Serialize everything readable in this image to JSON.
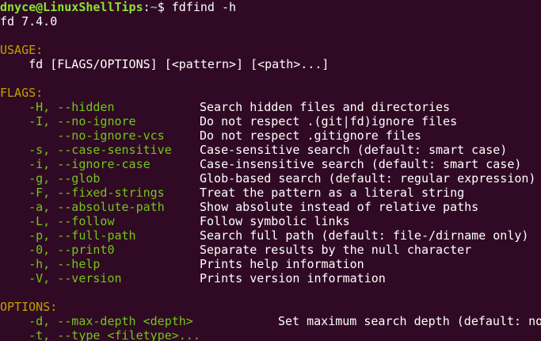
{
  "prompt": {
    "user_host": "dnyce@LinuxShellTips",
    "separator": ":",
    "cwd": "~",
    "symbol": "$",
    "command": "fdfind -h"
  },
  "version_line": "fd 7.4.0",
  "usage": {
    "header": "USAGE:",
    "line": "    fd [FLAGS/OPTIONS] [<pattern>] [<path>...]"
  },
  "flags": {
    "header": "FLAGS:",
    "items": [
      {
        "flag": "    -H, --hidden",
        "desc": "Search hidden files and directories"
      },
      {
        "flag": "    -I, --no-ignore",
        "desc": "Do not respect .(git|fd)ignore files"
      },
      {
        "flag": "        --no-ignore-vcs",
        "desc": "Do not respect .gitignore files"
      },
      {
        "flag": "    -s, --case-sensitive",
        "desc": "Case-sensitive search (default: smart case)"
      },
      {
        "flag": "    -i, --ignore-case",
        "desc": "Case-insensitive search (default: smart case)"
      },
      {
        "flag": "    -g, --glob",
        "desc": "Glob-based search (default: regular expression)"
      },
      {
        "flag": "    -F, --fixed-strings",
        "desc": "Treat the pattern as a literal string"
      },
      {
        "flag": "    -a, --absolute-path",
        "desc": "Show absolute instead of relative paths"
      },
      {
        "flag": "    -L, --follow",
        "desc": "Follow symbolic links"
      },
      {
        "flag": "    -p, --full-path",
        "desc": "Search full path (default: file-/dirname only)"
      },
      {
        "flag": "    -0, --print0",
        "desc": "Separate results by the null character"
      },
      {
        "flag": "    -h, --help",
        "desc": "Prints help information"
      },
      {
        "flag": "    -V, --version",
        "desc": "Prints version information"
      }
    ]
  },
  "options": {
    "header": "OPTIONS:",
    "items": [
      {
        "flag": "    -d, --max-depth <depth>",
        "desc": "Set maximum search depth (default: no"
      },
      {
        "flag": "    -t, --type <filetype>...",
        "desc": ""
      }
    ]
  },
  "colors": {
    "background": "#300a24",
    "prompt_user": "#8ae234",
    "prompt_path": "#729fcf",
    "section_header": "#c4a000",
    "flag_text": "#73c61a",
    "plain_text": "#ffffff"
  }
}
